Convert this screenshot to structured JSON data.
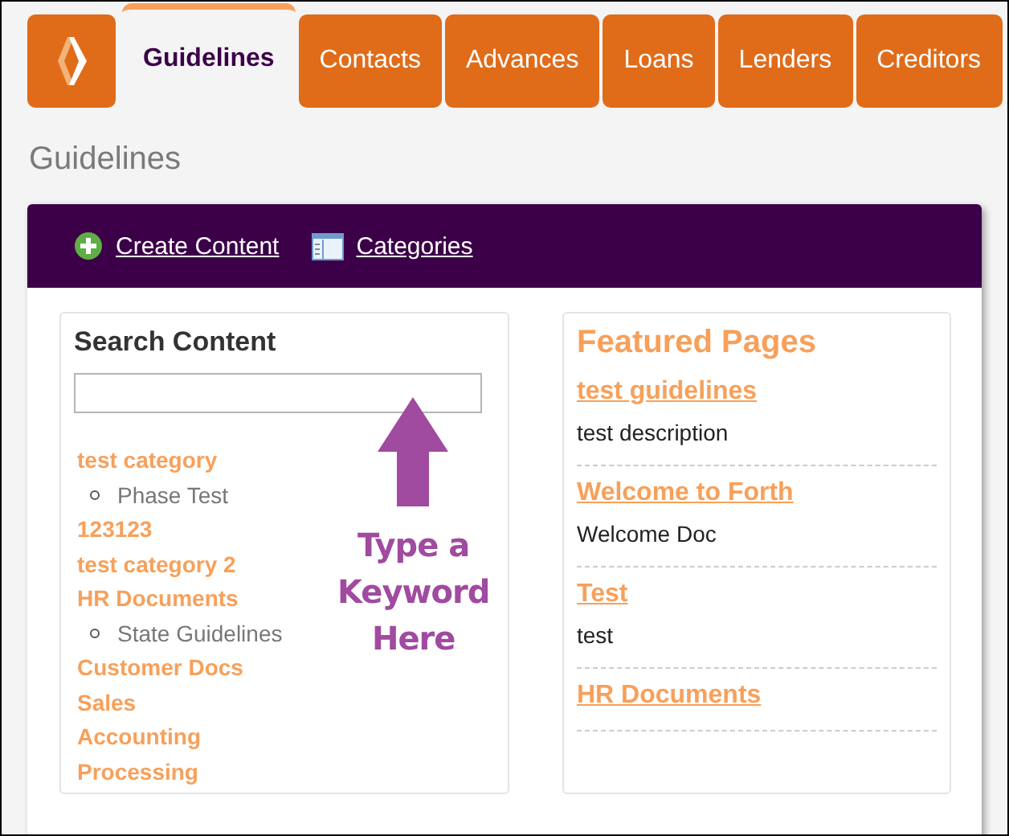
{
  "tabs": [
    {
      "label": "Guidelines",
      "selected": true
    },
    {
      "label": "Contacts",
      "selected": false
    },
    {
      "label": "Advances",
      "selected": false
    },
    {
      "label": "Loans",
      "selected": false
    },
    {
      "label": "Lenders",
      "selected": false
    },
    {
      "label": "Creditors",
      "selected": false
    }
  ],
  "page_title": "Guidelines",
  "toolbar": [
    {
      "label": "Create Content",
      "kind": "add"
    },
    {
      "label": "Categories",
      "kind": "categories"
    }
  ],
  "search": {
    "title": "Search Content"
  },
  "categories": [
    {
      "label": "test category",
      "children": [
        {
          "label": "Phase Test"
        }
      ]
    },
    {
      "label": "123123"
    },
    {
      "label": "test category 2"
    },
    {
      "label": "HR Documents",
      "children": [
        {
          "label": "State Guidelines"
        }
      ]
    },
    {
      "label": "Customer Docs"
    },
    {
      "label": "Sales"
    },
    {
      "label": "Accounting"
    },
    {
      "label": "Processing"
    }
  ],
  "annotation": {
    "lines": [
      "Type a",
      "Keyword",
      "Here"
    ]
  },
  "featured": {
    "title": "Featured Pages",
    "pages": [
      {
        "title": "test guidelines",
        "description": "test description"
      },
      {
        "title": "Welcome to Forth",
        "description": "Welcome Doc"
      },
      {
        "title": "Test",
        "description": "test"
      },
      {
        "title": "HR Documents"
      }
    ]
  }
}
